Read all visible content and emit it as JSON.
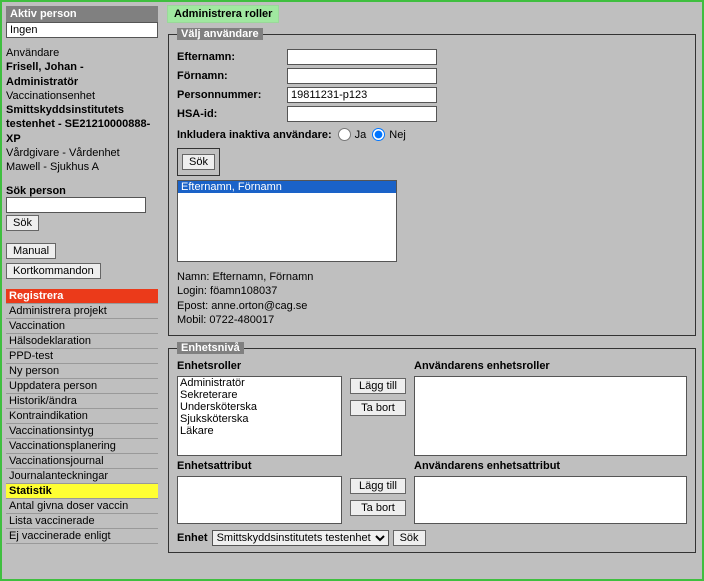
{
  "sidebar": {
    "aktiv_person_header": "Aktiv person",
    "aktiv_person_value": "Ingen",
    "user_label": "Användare",
    "user_name": "Frisell, Johan - Administratör",
    "unit_line1": "Vaccinationsenhet",
    "unit_line2": "Smittskyddsinstitutets testenhet - SE21210000888-XP",
    "caregiver_label": "Vårdgivare - Vårdenhet",
    "caregiver_value": "Mawell - Sjukhus A",
    "sok_person_label": "Sök person",
    "sok_btn": "Sök",
    "manual_btn": "Manual",
    "kortkom_btn": "Kortkommandon",
    "menu": [
      "Registrera",
      "Administrera projekt",
      "Vaccination",
      "Hälsodeklaration",
      "PPD-test",
      "Ny person",
      "Uppdatera person",
      "Historik/ändra",
      "Kontraindikation",
      "Vaccinationsintyg",
      "Vaccinationsplanering",
      "Vaccinationsjournal",
      "Journalanteckningar",
      "Statistik",
      "Antal givna doser vaccin",
      "Lista vaccinerade",
      "Ej vaccinerade enligt"
    ]
  },
  "main": {
    "title": "Administrera roller",
    "valj_legend": "Välj användare",
    "efternamn_label": "Efternamn:",
    "fornamn_label": "Förnamn:",
    "personnr_label": "Personnummer:",
    "personnr_value": "19811231-p123",
    "hsaid_label": "HSA-id:",
    "inaktiva_label": "Inkludera inaktiva användare:",
    "ja": "Ja",
    "nej": "Nej",
    "sok_btn": "Sök",
    "list_selected": "Efternamn, Förnamn",
    "details_name_label": "Namn:",
    "details_name_value": "Efternamn, Förnamn",
    "details_login_label": "Login:",
    "details_login_value": "föamn108037",
    "details_epost_label": "Epost:",
    "details_epost_value": "anne.orton@cag.se",
    "details_mobil_label": "Mobil:",
    "details_mobil_value": "0722-480017",
    "enhetsniva_legend": "Enhetsnivå",
    "enhetsroller_label": "Enhetsroller",
    "anv_enhetsroller_label": "Användarens enhetsroller",
    "enhetsattrib_label": "Enhetsattribut",
    "anv_enhetsattrib_label": "Användarens enhetsattribut",
    "roles": [
      "Administratör",
      "Sekreterare",
      "Undersköterska",
      "Sjuksköterska",
      "Läkare"
    ],
    "lagg_till": "Lägg till",
    "ta_bort": "Ta bort",
    "enhet_label": "Enhet",
    "enhet_selected": "Smittskyddsinstitutets testenhet",
    "sok_btn2": "Sök"
  }
}
